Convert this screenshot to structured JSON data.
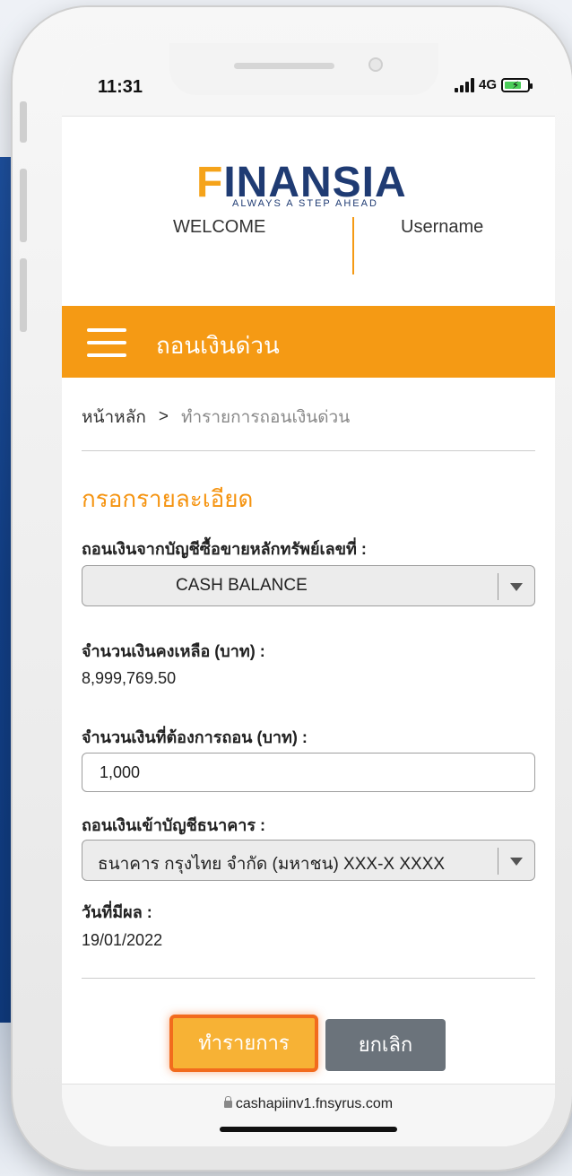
{
  "status_bar": {
    "time": "11:31",
    "network": "4G"
  },
  "header": {
    "brand_f": "F",
    "brand_rest": "INANSIA",
    "tagline": "ALWAYS A STEP AHEAD",
    "welcome": "WELCOME",
    "username": "Username"
  },
  "nav": {
    "title": "ถอนเงินด่วน"
  },
  "breadcrumb": {
    "home": "หน้าหลัก",
    "separator": ">",
    "current": "ทำรายการถอนเงินด่วน"
  },
  "form": {
    "section_title": "กรอกรายละเอียด",
    "from_account_label": "ถอนเงินจากบัญชีซื้อขายหลักทรัพย์เลขที่ :",
    "from_account_value": "CASH BALANCE",
    "balance_label": "จำนวนเงินคงเหลือ (บาท) :",
    "balance_value": "8,999,769.50",
    "amount_label": "จำนวนเงินที่ต้องการถอน (บาท) :",
    "amount_value": "1,000",
    "bank_label": "ถอนเงินเข้าบัญชีธนาคาร :",
    "bank_value": "ธนาคาร กรุงไทย จำกัด (มหาชน) XXX-X XXXX",
    "effective_date_label": "วันที่มีผล :",
    "effective_date_value": "19/01/2022"
  },
  "actions": {
    "confirm_label": "ทำรายการ",
    "cancel_label": "ยกเลิก"
  },
  "browser": {
    "url": "cashapiinv1.fnsyrus.com"
  },
  "colors": {
    "brand_orange": "#f59a14",
    "brand_navy": "#1f3b73",
    "confirm_border": "#f26b1d",
    "cancel_gray": "#6b737b"
  }
}
